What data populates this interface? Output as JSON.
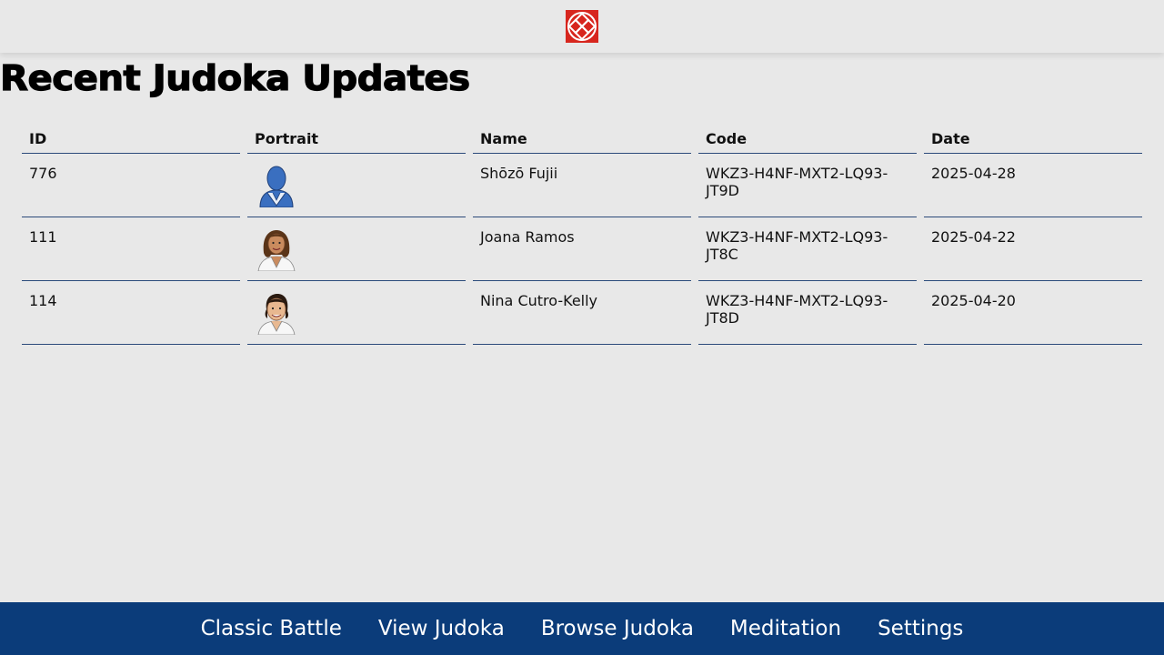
{
  "header": {
    "logo_icon": "judo-knot-logo-icon",
    "logo_color": "#d7261e"
  },
  "page": {
    "title": "Recent Judoka Updates"
  },
  "table": {
    "columns": [
      "ID",
      "Portrait",
      "Name",
      "Code",
      "Date"
    ],
    "rows": [
      {
        "id": "776",
        "portrait": "placeholder-silhouette",
        "name": "Shōzō Fujii",
        "code": "WKZ3-H4NF-MXT2-LQ93-JT9D",
        "date": "2025-04-28"
      },
      {
        "id": "111",
        "portrait": "long-hair-judoka",
        "name": "Joana Ramos",
        "code": "WKZ3-H4NF-MXT2-LQ93-JT8C",
        "date": "2025-04-22"
      },
      {
        "id": "114",
        "portrait": "short-hair-judoka",
        "name": "Nina Cutro-Kelly",
        "code": "WKZ3-H4NF-MXT2-LQ93-JT8D",
        "date": "2025-04-20"
      }
    ]
  },
  "nav": {
    "items": [
      "Classic Battle",
      "View Judoka",
      "Browse Judoka",
      "Meditation",
      "Settings"
    ],
    "background": "#0b3c7a"
  },
  "colors": {
    "page_bg": "#e8e8e8",
    "row_border": "#2b4a7a"
  }
}
